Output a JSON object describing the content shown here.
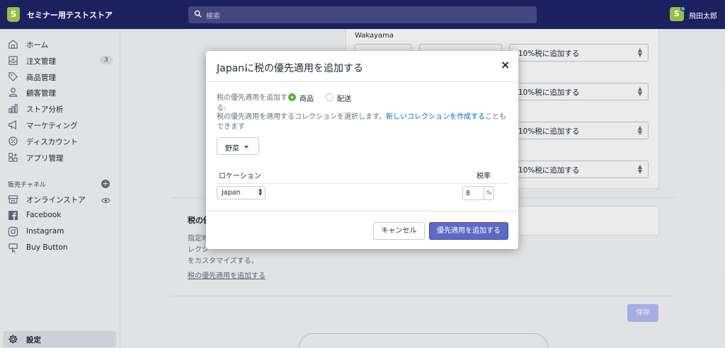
{
  "topbar": {
    "store_logo": "S",
    "store_name": "セミナー用テストストア",
    "store_chevron": "⌄",
    "search_placeholder": "検索",
    "user_initial": "S",
    "user_name": "飛田太郎"
  },
  "sidebar": {
    "items": [
      {
        "label": "ホーム",
        "icon": "home-icon"
      },
      {
        "label": "注文管理",
        "icon": "orders-icon",
        "badge": "3"
      },
      {
        "label": "商品管理",
        "icon": "tag-icon"
      },
      {
        "label": "顧客管理",
        "icon": "person-icon"
      },
      {
        "label": "ストア分析",
        "icon": "bar-chart-icon"
      },
      {
        "label": "マーケティング",
        "icon": "megaphone-icon"
      },
      {
        "label": "ディスカウント",
        "icon": "discount-icon"
      },
      {
        "label": "アプリ管理",
        "icon": "apps-icon"
      }
    ],
    "channels_label": "販売チャネル",
    "channels": [
      {
        "label": "オンラインストア",
        "icon": "store-icon"
      },
      {
        "label": "Facebook",
        "icon": "facebook-icon"
      },
      {
        "label": "Instagram",
        "icon": "instagram-icon"
      },
      {
        "label": "Buy Button",
        "icon": "buy-button-icon"
      }
    ],
    "settings_label": "設定"
  },
  "background": {
    "region_label": "Wakayama",
    "rows": [
      {
        "tax_option": "10%税に追加する"
      },
      {
        "tax_option": "10%税に追加する"
      },
      {
        "tax_option": "10%税に追加する"
      },
      {
        "tax_option": "10%税に追加する"
      }
    ],
    "section_title": "税の優",
    "section_desc": "指定地\nレクシ\nをカスタマイズする。",
    "section_link": "税の優先適用を追加する",
    "save_label": "保存"
  },
  "modal": {
    "title": "Japanに税の優先適用を追加する",
    "close": "×",
    "apply_label": "税の優先適用を追加する:",
    "radio_products": "商品",
    "radio_shipping": "配送",
    "help_text": "税の優先適用を適用するコレクションを選択します。",
    "help_link": "新しいコレクションを作成する",
    "help_suffix": "こともできます",
    "collection": "野菜",
    "col_location": "ロケーション",
    "col_rate": "税率",
    "location_value": "Japan",
    "rate_value": "8",
    "rate_suffix": "%",
    "cancel_label": "キャンセル",
    "submit_label": "優先適用を追加する"
  },
  "colors": {
    "topbar": "#1c2260",
    "brand_green": "#95bf47",
    "primary": "#5c6ac4",
    "link": "#006fbb",
    "radio_on": "#50b83c"
  }
}
